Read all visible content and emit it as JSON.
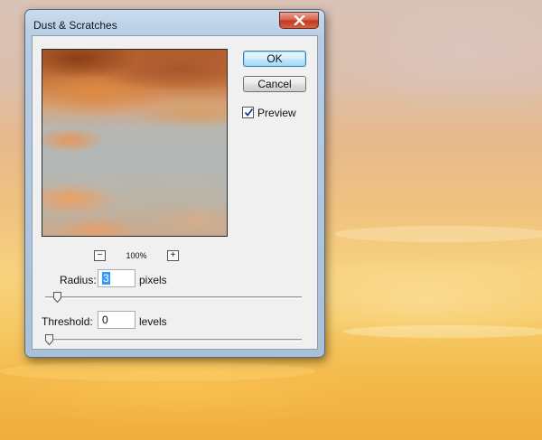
{
  "dialog": {
    "title": "Dust & Scratches",
    "close_icon": "close-icon",
    "preview": {
      "zoom_out_label": "−",
      "zoom_level": "100%",
      "zoom_in_label": "+"
    },
    "buttons": {
      "ok": "OK",
      "cancel": "Cancel"
    },
    "preview_checkbox": {
      "label": "Preview",
      "checked": true
    },
    "radius": {
      "label": "Radius:",
      "value": "3",
      "unit": "pixels",
      "slider_fraction": 0.03
    },
    "threshold": {
      "label": "Threshold:",
      "value": "0",
      "unit": "levels",
      "slider_fraction": 0.0
    }
  },
  "colors": {
    "accent_selection": "#3399ff",
    "close_button": "#c23a23",
    "default_button_border": "#3c7fb1"
  }
}
